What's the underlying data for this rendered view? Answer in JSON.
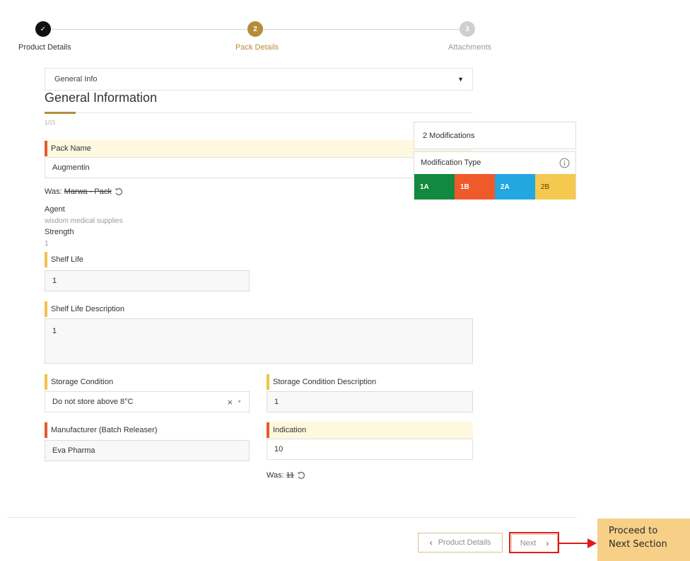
{
  "stepper": {
    "steps": [
      {
        "number": "1",
        "label": "Product Details",
        "state": "completed",
        "color": "#111111"
      },
      {
        "number": "2",
        "label": "Pack Details",
        "state": "active",
        "color": "#b38d3b"
      },
      {
        "number": "3",
        "label": "Attachments",
        "state": "pending",
        "color": "#cfcfcf"
      }
    ],
    "check_glyph": "✓"
  },
  "section_select": {
    "value": "General Info"
  },
  "section": {
    "title": "General Information",
    "counter": "1/15"
  },
  "fields": {
    "pack_name": {
      "label": "Pack Name",
      "value": "Augmentin",
      "was_label": "Was:",
      "was_value": "Marwa - Pack"
    },
    "agent": {
      "label": "Agent",
      "value": "wisdom medical supplies"
    },
    "strength": {
      "label": "Strength",
      "value": "1"
    },
    "shelf_life": {
      "label": "Shelf Life",
      "value": "1"
    },
    "shelf_life_description": {
      "label": "Shelf Life Description",
      "value": "1"
    },
    "storage_condition": {
      "label": "Storage Condition",
      "value": "Do not store above 8°C",
      "clear_glyph": "×"
    },
    "storage_condition_description": {
      "label": "Storage Condition Description",
      "value": "1"
    },
    "manufacturer": {
      "label": "Manufacturer (Batch Releaser)",
      "value": "Eva Pharma"
    },
    "indication": {
      "label": "Indication",
      "value": "10",
      "was_label": "Was:",
      "was_value": "11"
    }
  },
  "modifications": {
    "count_label": "2 Modifications",
    "type_label": "Modification Type",
    "types": [
      {
        "label": "1A",
        "color": "#13893f"
      },
      {
        "label": "1B",
        "color": "#ef5a2a"
      },
      {
        "label": "2A",
        "color": "#22a7e0"
      },
      {
        "label": "2B",
        "color": "#f5c84f"
      }
    ]
  },
  "footer": {
    "back_label": "Product Details",
    "back_chevron": "‹",
    "next_label": "Next",
    "next_chevron": "›",
    "callout": {
      "line1": "Proceed to",
      "line2": "Next Section"
    }
  },
  "colors": {
    "accent": "#b38d3b",
    "required": "#e8582b",
    "optional": "#f3c14a",
    "callout_red": "#e01a1a",
    "callout_bg": "#f7cf86"
  }
}
